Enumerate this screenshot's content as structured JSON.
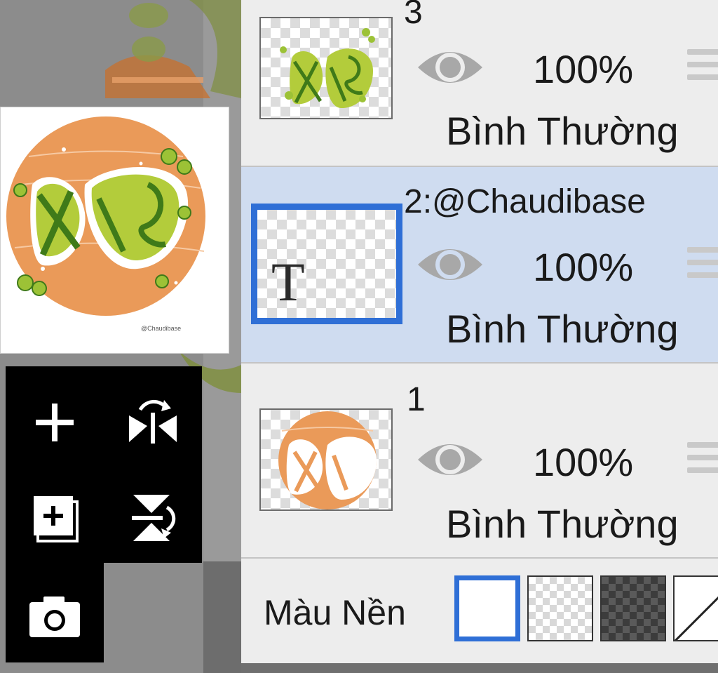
{
  "layers": [
    {
      "name": "3",
      "opacity": "100%",
      "blend": "Bình Thường",
      "selected": false
    },
    {
      "name": "2:@Chaudibase",
      "opacity": "100%",
      "blend": "Bình Thường",
      "selected": true,
      "thumb_text": "T"
    },
    {
      "name": "1",
      "opacity": "100%",
      "blend": "Bình Thường",
      "selected": false
    }
  ],
  "background": {
    "label": "Màu Nền",
    "options": [
      "white",
      "transparent-light",
      "transparent-dark",
      "none"
    ],
    "selected": "white"
  },
  "preview": {
    "artwork_text": "xe",
    "credit_text": "@Chaudibase"
  },
  "toolbox": {
    "icons": [
      "add-layer-icon",
      "flip-horizontal-icon",
      "duplicate-layer-icon",
      "flip-vertical-icon",
      "camera-icon"
    ]
  },
  "colors": {
    "accent": "#2f6fd6",
    "selected_row": "#cfdcf0",
    "panel_bg": "#ededed",
    "artwork_orange": "#ea9a59",
    "artwork_green": "#9cc236"
  }
}
